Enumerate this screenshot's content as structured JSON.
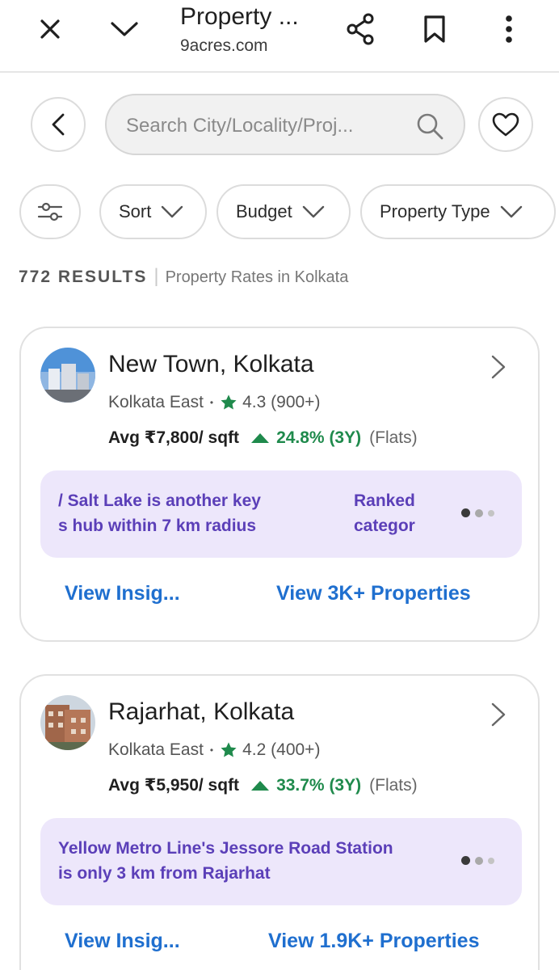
{
  "browser": {
    "title": "Property ...",
    "url": "9acres.com"
  },
  "search": {
    "placeholder": "Search City/Locality/Proj..."
  },
  "filters": [
    {
      "label": "Sort"
    },
    {
      "label": "Budget"
    },
    {
      "label": "Property Type"
    }
  ],
  "results": {
    "count": "772 RESULTS",
    "separator": "|",
    "subtitle": "Property Rates in Kolkata"
  },
  "cards": [
    {
      "title": "New Town, Kolkata",
      "zone": "Kolkata East",
      "bullet": "•",
      "rating": "4.3",
      "reviews": "(900+)",
      "price": "Avg ₹7,800/ sqft",
      "growth": "24.8% (3Y)",
      "type": "(Flats)",
      "insight_left": "/ Salt Lake is another key\ns hub within 7 km radius",
      "insight_right": "Ranked\ncategor",
      "view_insights": "View Insig...",
      "view_properties": "View 3K+ Properties"
    },
    {
      "title": "Rajarhat, Kolkata",
      "zone": "Kolkata East",
      "bullet": "•",
      "rating": "4.2",
      "reviews": "(400+)",
      "price": "Avg ₹5,950/ sqft",
      "growth": "33.7% (3Y)",
      "type": "(Flats)",
      "insight_left": "Yellow Metro Line's Jessore Road Station\nis only 3 km from Rajarhat",
      "view_insights": "View Insig...",
      "view_properties": "View 1.9K+ Properties"
    }
  ],
  "colors": {
    "link": "#1f6fcf",
    "growth": "#1f8a4c",
    "insight_bg": "#ede7fb",
    "insight_text": "#5b3fb8"
  }
}
